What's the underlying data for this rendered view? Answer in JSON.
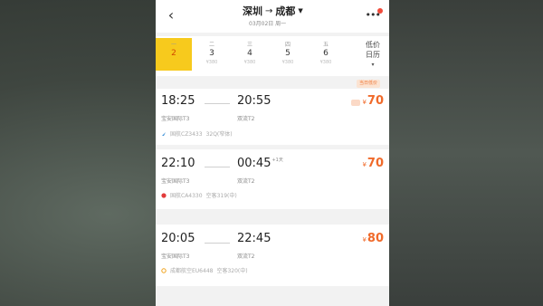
{
  "header": {
    "from_city": "深圳",
    "arrow": "→",
    "to_city": "成都",
    "subtitle": "03月02日 周一"
  },
  "datebar": {
    "days": [
      {
        "weekday": "一",
        "date": "2",
        "price": "",
        "selected": true
      },
      {
        "weekday": "二",
        "date": "3",
        "price": "¥380",
        "selected": false
      },
      {
        "weekday": "三",
        "date": "4",
        "price": "¥380",
        "selected": false
      },
      {
        "weekday": "四",
        "date": "5",
        "price": "¥380",
        "selected": false
      },
      {
        "weekday": "五",
        "date": "6",
        "price": "¥380",
        "selected": false
      }
    ],
    "calendar_line1": "低价",
    "calendar_line2": "日历",
    "calendar_chevron": "▾"
  },
  "tag": "当日低价",
  "flights": [
    {
      "dep_time": "18:25",
      "arr_time": "20:55",
      "plus_day": "",
      "dep_airport": "宝安国际T3",
      "arr_airport": "双流T2",
      "info_airline": "国航CZ3433",
      "info_extra": "32Q(窄体)",
      "currency": "¥",
      "price": "70",
      "icon": "sail-icon",
      "icon_color": "#3a8fd8"
    },
    {
      "dep_time": "22:10",
      "arr_time": "00:45",
      "plus_day": "+1天",
      "dep_airport": "宝安国际T3",
      "arr_airport": "双流T2",
      "info_airline": "国航CA4330",
      "info_extra": "空客319(中)",
      "currency": "¥",
      "price": "70",
      "icon": "phoenix-icon",
      "icon_color": "#e23b3b"
    },
    {
      "dep_time": "20:05",
      "arr_time": "22:45",
      "plus_day": "",
      "dep_airport": "宝安国际T3",
      "arr_airport": "双流T2",
      "info_airline": "成都航空EU6448",
      "info_extra": "空客320(中)",
      "currency": "¥",
      "price": "80",
      "icon": "ring-icon",
      "icon_color": "#f0a21b"
    }
  ],
  "colors": {
    "accent": "#f7ca1d",
    "price": "#f06a2a"
  }
}
